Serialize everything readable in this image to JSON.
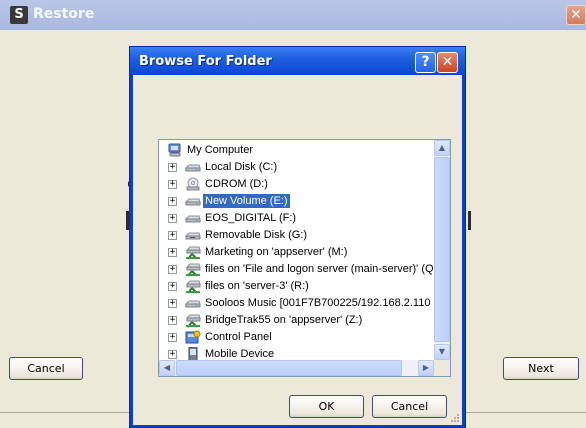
{
  "restore_window": {
    "app_icon_letter": "S",
    "title": "Restore",
    "close_glyph": "✕",
    "cancel_label": "Cancel",
    "next_label": "Next"
  },
  "dialog": {
    "title": "Browse For Folder",
    "help_glyph": "?",
    "close_glyph": "✕",
    "ok_label": "OK",
    "cancel_label": "Cancel",
    "tree": {
      "root": {
        "label": "My Computer",
        "icon": "my-computer-icon"
      },
      "items": [
        {
          "label": "Local Disk (C:)",
          "icon": "hard-drive-icon",
          "selected": false
        },
        {
          "label": "CDROM (D:)",
          "icon": "cdrom-icon",
          "selected": false
        },
        {
          "label": "New Volume (E:)",
          "icon": "hard-drive-icon",
          "selected": true
        },
        {
          "label": "EOS_DIGITAL (F:)",
          "icon": "hard-drive-icon",
          "selected": false
        },
        {
          "label": "Removable Disk (G:)",
          "icon": "removable-drive-icon",
          "selected": false
        },
        {
          "label": "Marketing on 'appserver' (M:)",
          "icon": "network-drive-icon",
          "selected": false
        },
        {
          "label": "files on 'File and logon server (main-server)' (Q",
          "icon": "network-drive-icon",
          "selected": false
        },
        {
          "label": "files on 'server-3' (R:)",
          "icon": "network-drive-icon",
          "selected": false
        },
        {
          "label": "Sooloos Music [001F7B700225/192.168.2.110",
          "icon": "hard-drive-icon",
          "selected": false
        },
        {
          "label": "BridgeTrak55 on 'appserver' (Z:)",
          "icon": "network-drive-icon",
          "selected": false
        },
        {
          "label": "Control Panel",
          "icon": "control-panel-icon",
          "selected": false
        },
        {
          "label": "Mobile Device",
          "icon": "mobile-device-icon",
          "selected": false
        }
      ]
    }
  },
  "colors": {
    "selection": "#316ac5",
    "dialog_title_bar": "#0b47d3",
    "parent_title_bar": "#a9b8df",
    "window_face": "#ece9d8"
  }
}
